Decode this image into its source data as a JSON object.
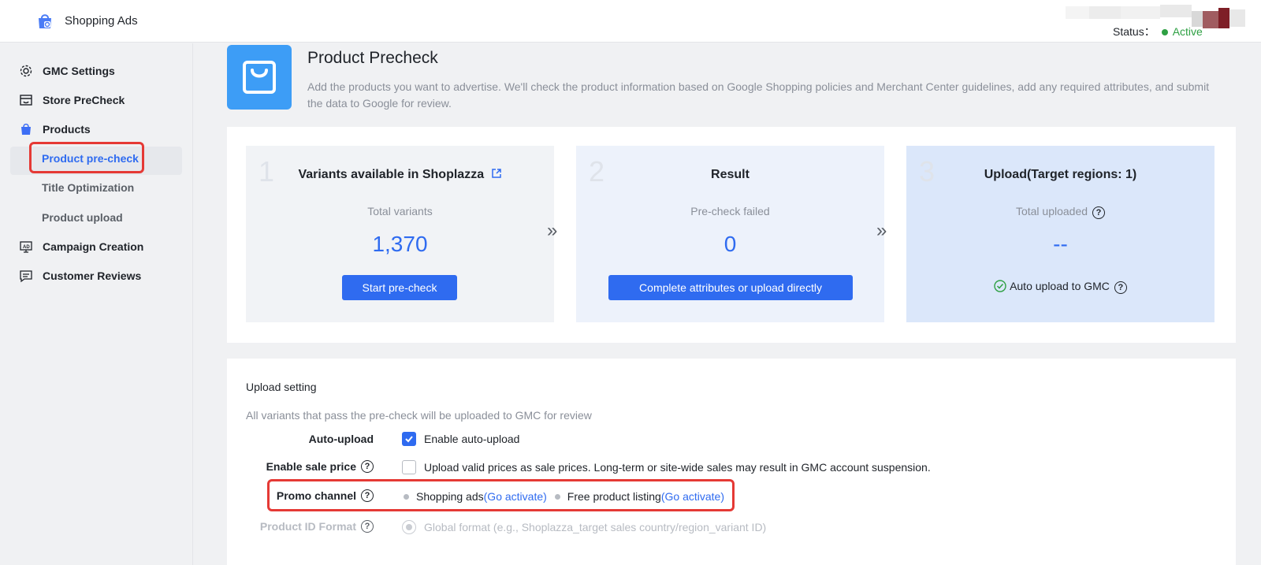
{
  "header": {
    "app_title": "Shopping Ads",
    "status_label": "Status：",
    "status_value": "Active"
  },
  "sidebar": {
    "items": [
      {
        "label": "GMC Settings",
        "icon": "gear-icon"
      },
      {
        "label": "Store PreCheck",
        "icon": "store-icon"
      },
      {
        "label": "Products",
        "icon": "shopping-bag-icon"
      },
      {
        "label": "Campaign Creation",
        "icon": "ad-icon"
      },
      {
        "label": "Customer Reviews",
        "icon": "message-icon"
      }
    ],
    "product_subitems": [
      {
        "label": "Product pre-check",
        "active": true
      },
      {
        "label": "Title Optimization",
        "active": false
      },
      {
        "label": "Product upload",
        "active": false
      }
    ]
  },
  "page": {
    "title": "Product Precheck",
    "description": "Add the products you want to advertise. We'll check the product information based on Google Shopping policies and Merchant Center guidelines, add any required attributes, and submit the data to Google for review."
  },
  "steps": [
    {
      "num": "1",
      "title": "Variants available in Shoplazza",
      "subtitle": "Total variants",
      "value": "1,370",
      "button": "Start pre-check"
    },
    {
      "num": "2",
      "title": "Result",
      "subtitle": "Pre-check failed",
      "value": "0",
      "button": "Complete attributes or upload directly"
    },
    {
      "num": "3",
      "title": "Upload(Target regions: 1)",
      "subtitle": "Total uploaded",
      "value": "--",
      "note": "Auto upload to GMC"
    }
  ],
  "arrow_glyph": "»",
  "upload_setting": {
    "title": "Upload setting",
    "description": "All variants that pass the pre-check will be uploaded to GMC for review",
    "auto_upload": {
      "label": "Auto-upload",
      "option": "Enable auto-upload",
      "checked": true
    },
    "sale_price": {
      "label": "Enable sale price",
      "option": "Upload valid prices as sale prices. Long-term or site-wide sales may result in GMC account suspension.",
      "checked": false
    },
    "promo_channel": {
      "label": "Promo channel",
      "channels": [
        {
          "name": "Shopping ads",
          "link": "(Go activate)"
        },
        {
          "name": "Free product listing",
          "link": "(Go activate)"
        }
      ]
    },
    "id_format": {
      "label": "Product ID Format",
      "option": "Global format (e.g., Shoplazza_target sales country/region_variant ID)"
    }
  },
  "colors": {
    "accent": "#2f6bf0",
    "status_active": "#2ea043",
    "highlight": "#e53935",
    "hero_icon": "#3d9df6"
  }
}
